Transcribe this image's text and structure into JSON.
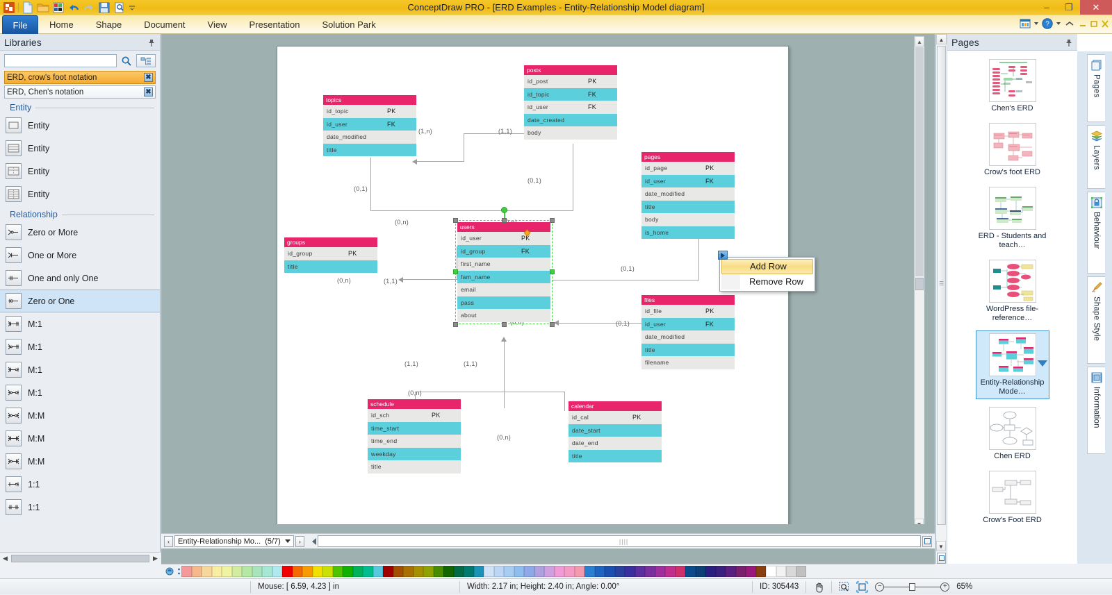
{
  "window": {
    "title": "ConceptDraw PRO - [ERD Examples - Entity-Relationship Model diagram]",
    "minimize": "–",
    "restore": "❐",
    "close": "✕"
  },
  "quick_access": [
    "app-logo-icon",
    "new-document-icon",
    "open-folder-icon",
    "chart-icon",
    "undo-icon",
    "redo-icon",
    "save-icon",
    "print-preview-icon",
    "customize-qat-icon"
  ],
  "ribbon": {
    "tabs": [
      {
        "label": "File",
        "active": true
      },
      {
        "label": "Home",
        "active": false
      },
      {
        "label": "Shape",
        "active": false
      },
      {
        "label": "Document",
        "active": false
      },
      {
        "label": "View",
        "active": false
      },
      {
        "label": "Presentation",
        "active": false
      },
      {
        "label": "Solution Park",
        "active": false
      }
    ]
  },
  "libraries": {
    "title": "Libraries",
    "search_value": "",
    "search_placeholder": "",
    "tabs": [
      {
        "label": "ERD, crow's foot notation",
        "active": true
      },
      {
        "label": "ERD, Chen's notation",
        "active": false
      }
    ],
    "groups": [
      {
        "name": "Entity",
        "items": [
          {
            "label": "Entity",
            "icon": "entity-plain-icon",
            "selected": false
          },
          {
            "label": "Entity",
            "icon": "entity-rows-icon",
            "selected": false
          },
          {
            "label": "Entity",
            "icon": "entity-key-icon",
            "selected": false
          },
          {
            "label": "Entity",
            "icon": "entity-key-rows-icon",
            "selected": false
          }
        ]
      },
      {
        "name": "Relationship",
        "items": [
          {
            "label": "Zero or More",
            "icon": "rel-zero-or-more-icon",
            "selected": false
          },
          {
            "label": "One or More",
            "icon": "rel-one-or-more-icon",
            "selected": false
          },
          {
            "label": "One and only One",
            "icon": "rel-one-and-only-one-icon",
            "selected": false
          },
          {
            "label": "Zero or One",
            "icon": "rel-zero-or-one-icon",
            "selected": true
          },
          {
            "label": "M:1",
            "icon": "rel-m1-a-icon",
            "selected": false
          },
          {
            "label": "M:1",
            "icon": "rel-m1-b-icon",
            "selected": false
          },
          {
            "label": "M:1",
            "icon": "rel-m1-c-icon",
            "selected": false
          },
          {
            "label": "M:1",
            "icon": "rel-m1-d-icon",
            "selected": false
          },
          {
            "label": "M:M",
            "icon": "rel-mm-a-icon",
            "selected": false
          },
          {
            "label": "M:M",
            "icon": "rel-mm-b-icon",
            "selected": false
          },
          {
            "label": "M:M",
            "icon": "rel-mm-c-icon",
            "selected": false
          },
          {
            "label": "1:1",
            "icon": "rel-11-a-icon",
            "selected": false
          },
          {
            "label": "1:1",
            "icon": "rel-11-b-icon",
            "selected": false
          }
        ]
      }
    ]
  },
  "context_menu": {
    "items": [
      {
        "label": "Add Row",
        "highlighted": true
      },
      {
        "label": "Remove Row",
        "highlighted": false
      }
    ]
  },
  "diagram": {
    "colors": {
      "header": "#e8246a",
      "row_even": "#5bcfdc",
      "row_odd": "#e8e8e6",
      "connector": "#a6a6a6",
      "selection": "#4bd24b"
    },
    "entities": [
      {
        "name": "topics",
        "rows": [
          {
            "field": "id_topic",
            "key": "PK"
          },
          {
            "field": "id_user",
            "key": "FK"
          },
          {
            "field": "date_modified",
            "key": ""
          },
          {
            "field": "title",
            "key": ""
          }
        ]
      },
      {
        "name": "posts",
        "rows": [
          {
            "field": "id_post",
            "key": "PK"
          },
          {
            "field": "id_topic",
            "key": "FK"
          },
          {
            "field": "id_user",
            "key": "FK"
          },
          {
            "field": "date_created",
            "key": ""
          },
          {
            "field": "body",
            "key": ""
          }
        ]
      },
      {
        "name": "pages",
        "rows": [
          {
            "field": "id_page",
            "key": "PK"
          },
          {
            "field": "id_user",
            "key": "FK"
          },
          {
            "field": "date_modified",
            "key": ""
          },
          {
            "field": "title",
            "key": ""
          },
          {
            "field": "body",
            "key": ""
          },
          {
            "field": "is_home",
            "key": ""
          }
        ]
      },
      {
        "name": "groups",
        "rows": [
          {
            "field": "id_group",
            "key": "PK"
          },
          {
            "field": "title",
            "key": ""
          }
        ]
      },
      {
        "name": "users",
        "selected": true,
        "rows": [
          {
            "field": "id_user",
            "key": "PK"
          },
          {
            "field": "id_group",
            "key": "FK"
          },
          {
            "field": "first_name",
            "key": ""
          },
          {
            "field": "fam_name",
            "key": ""
          },
          {
            "field": "email",
            "key": ""
          },
          {
            "field": "pass",
            "key": ""
          },
          {
            "field": "about",
            "key": ""
          }
        ]
      },
      {
        "name": "files",
        "rows": [
          {
            "field": "id_file",
            "key": "PK"
          },
          {
            "field": "id_user",
            "key": "FK"
          },
          {
            "field": "date_modified",
            "key": ""
          },
          {
            "field": "title",
            "key": ""
          },
          {
            "field": "filename",
            "key": ""
          }
        ]
      },
      {
        "name": "schedule",
        "rows": [
          {
            "field": "id_sch",
            "key": "PK"
          },
          {
            "field": "time_start",
            "key": ""
          },
          {
            "field": "time_end",
            "key": ""
          },
          {
            "field": "weekday",
            "key": ""
          },
          {
            "field": "title",
            "key": ""
          }
        ]
      },
      {
        "name": "calendar",
        "rows": [
          {
            "field": "id_cal",
            "key": "PK"
          },
          {
            "field": "date_start",
            "key": ""
          },
          {
            "field": "date_end",
            "key": ""
          },
          {
            "field": "title",
            "key": ""
          }
        ]
      }
    ],
    "cardinalities": [
      "(1,n)",
      "(1,1)",
      "(0,1)",
      "(0,1)",
      "(0,1)",
      "(0,n)",
      "(0,n)",
      "(0,n)",
      "(1,1)",
      "(0,n)",
      "(0,1)",
      "(0,n)",
      "(0,1)",
      "(1,1)",
      "(1,1)",
      "(0,n)",
      "(0,n)"
    ]
  },
  "page_tab": {
    "prev": "‹",
    "next": "›",
    "name": "Entity-Relationship Mo...",
    "counter": "(5/7)"
  },
  "pages_panel": {
    "title": "Pages",
    "items": [
      {
        "caption": "Chen's ERD",
        "selected": false
      },
      {
        "caption": "Crow's foot ERD",
        "selected": false
      },
      {
        "caption": "ERD - Students and teach…",
        "selected": false
      },
      {
        "caption": "WordPress file-reference…",
        "selected": false
      },
      {
        "caption": "Entity-Relationship Mode…",
        "selected": true
      },
      {
        "caption": "Chen ERD",
        "selected": false
      },
      {
        "caption": "Crow's Foot ERD",
        "selected": false
      }
    ],
    "dock_tabs": [
      {
        "label": "Pages",
        "icon": "pages-stack-icon",
        "active": true
      },
      {
        "label": "Layers",
        "icon": "layers-icon",
        "active": false
      },
      {
        "label": "Behaviour",
        "icon": "behaviour-lock-icon",
        "active": false
      },
      {
        "label": "Shape Style",
        "icon": "shape-style-brush-icon",
        "active": false
      },
      {
        "label": "Information",
        "icon": "information-icon",
        "active": false
      }
    ]
  },
  "palette": {
    "swatches": [
      "#f49a9a",
      "#f5b98c",
      "#f7d79b",
      "#f8eda1",
      "#eff3a2",
      "#d3edA0",
      "#b6e8a5",
      "#a8e5bd",
      "#a6e7d6",
      "#ade9ef",
      "#f00000",
      "#f36b00",
      "#f79b00",
      "#f2e000",
      "#c9e000",
      "#4ec300",
      "#12b000",
      "#00b25c",
      "#00bd8e",
      "#57c8e0",
      "#a00000",
      "#a44e00",
      "#a87000",
      "#a49000",
      "#8fa300",
      "#4a8c00",
      "#116600",
      "#006b46",
      "#00796e",
      "#1b93b8",
      "#cfe2f7",
      "#bcd7f5",
      "#a8cdf3",
      "#8fbdef",
      "#8fa8e8",
      "#b0a0e0",
      "#cf9fe0",
      "#f09ad8",
      "#f49ac4",
      "#f49aae",
      "#2b7fd0",
      "#1f63c0",
      "#1a4fb0",
      "#2a3f9e",
      "#3a2f9e",
      "#5b2f9e",
      "#7a2f9e",
      "#a02f9e",
      "#c02f8e",
      "#d02f6e",
      "#0d4a8c",
      "#0b3f76",
      "#2a1f7e",
      "#3a1f7e",
      "#5a1f7e",
      "#7a1f6e",
      "#99197a",
      "#8a3f10",
      "#ffffff",
      "#f2f2f2",
      "#d9d9d9",
      "#c0c0c0"
    ]
  },
  "status": {
    "mouse": "Mouse: [ 6.59, 4.23 ] in",
    "dimensions": "Width: 2.17 in;  Height: 2.40 in;  Angle: 0.00°",
    "id": "ID: 305443",
    "zoom": "65%",
    "tools": [
      "pan-hand-icon",
      "zoom-select-icon",
      "fit-page-icon"
    ],
    "zoom_out": "−",
    "zoom_in": "+"
  }
}
